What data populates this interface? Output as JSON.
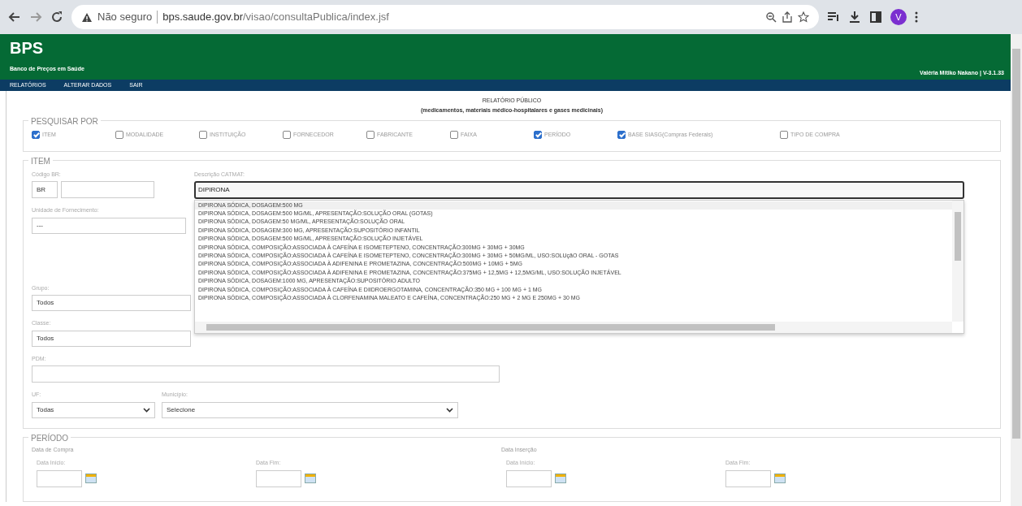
{
  "browser": {
    "security": "Não seguro",
    "url_host": "bps.saude.gov.br",
    "url_path": "/visao/consultaPublica/index.jsf",
    "profile": "V"
  },
  "header": {
    "title": "BPS",
    "subtitle": "Banco de Preços em Saúde",
    "user": "Valéria Mitiko Nakano | V-3.1.33"
  },
  "menu": [
    "RELATÓRIOS",
    "ALTERAR DADOS",
    "SAIR"
  ],
  "report": {
    "title": "RELATÓRIO PÚBLICO",
    "subtitle": "(medicamentos, materiais médico-hospitalares e gases medicinais)"
  },
  "search_by": {
    "legend": "PESQUISAR POR",
    "options": [
      {
        "label": "ITEM",
        "checked": true
      },
      {
        "label": "MODALIDADE",
        "checked": false
      },
      {
        "label": "INSTITUIÇÃO",
        "checked": false
      },
      {
        "label": "FORNECEDOR",
        "checked": false
      },
      {
        "label": "FABRICANTE",
        "checked": false
      },
      {
        "label": "FAIXA",
        "checked": false
      },
      {
        "label": "PERÍODO",
        "checked": true
      },
      {
        "label": "BASE SIASG(Compras Federais)",
        "checked": true
      },
      {
        "label": "TIPO DE COMPRA",
        "checked": false
      }
    ]
  },
  "item": {
    "legend": "ITEM",
    "codigo_label": "Código BR:",
    "codigo_prefix": "BR",
    "catmat_label": "Descrição CATMAT:",
    "catmat_value": "DIPIRONA",
    "suggestions": [
      {
        "text": "DIPIRONA SÓDICA, DOSAGEM:500 MG",
        "selected": true
      },
      {
        "text": "DIPIRONA SÓDICA, DOSAGEM:500 MG/ML, APRESENTAÇÃO:SOLUÇÃO ORAL (GOTAS)",
        "selected": false
      },
      {
        "text": "DIPIRONA SÓDICA, DOSAGEM:50 MG/ML, APRESENTAÇÃO:SOLUÇÃO ORAL",
        "selected": false
      },
      {
        "text": "DIPIRONA SÓDICA, DOSAGEM:300 MG, APRESENTAÇÃO:SUPOSITÓRIO INFANTIL",
        "selected": false
      },
      {
        "text": "DIPIRONA SÓDICA, DOSAGEM:500 MG/ML, APRESENTAÇÃO:SOLUÇÃO INJETÁVEL",
        "selected": false
      },
      {
        "text": "DIPIRONA SÓDICA, COMPOSIÇÃO:ASSOCIADA À CAFEÍNA E ISOMETEPTENO, CONCENTRAÇÃO:300MG + 30MG + 30MG",
        "selected": false
      },
      {
        "text": "DIPIRONA SÓDICA, COMPOSIÇÃO:ASSOCIADA À CAFEÍNA E ISOMETEPTENO, CONCENTRAÇÃO:300MG + 30MG + 50MG/ML, USO:SOLUçãO ORAL - GOTAS",
        "selected": false
      },
      {
        "text": "DIPIRONA SÓDICA, COMPOSIÇÃO:ASSOCIADA À ADIFENINA E PROMETAZINA, CONCENTRAÇÃO:500MG + 10MG + 5MG",
        "selected": false
      },
      {
        "text": "DIPIRONA SÓDICA, COMPOSIÇÃO:ASSOCIADA À ADIFENINA E PROMETAZINA, CONCENTRAÇÃO:375MG + 12,5MG + 12,5MG/ML, USO:SOLUÇÃO INJETÁVEL",
        "selected": false
      },
      {
        "text": "DIPIRONA SÓDICA, DOSAGEM:1000 MG, APRESENTAÇÃO:SUPOSITÓRIO ADULTO",
        "selected": false
      },
      {
        "text": "DIPIRONA SÓDICA, COMPOSIÇÃO:ASSOCIADA À CAFEÍNA E DIIDROERGOTAMINA, CONCENTRAÇÃO:350 MG + 100 MG + 1 MG",
        "selected": false
      },
      {
        "text": "DIPIRONA SÓDICA, COMPOSIÇÃO:ASSOCIADA À CLORFENAMINA MALEATO E CAFEÍNA, CONCENTRAÇÃO:250 MG + 2 MG E 250MG + 30 MG",
        "selected": false
      }
    ],
    "unidade_label": "Unidade de Fornecimento:",
    "unidade_value": "---",
    "grupo_label": "Grupo:",
    "grupo_value": "Todos",
    "classe_label": "Classe:",
    "classe_value": "Todos",
    "pdm_label": "PDM:",
    "uf_label": "UF:",
    "uf_value": "Todas",
    "municipio_label": "Município:",
    "municipio_value": "Selecione"
  },
  "periodo": {
    "legend": "PERÍODO",
    "groups": [
      {
        "label": "Data de Compra",
        "start_label": "Data Início:",
        "end_label": "Data Fim:"
      },
      {
        "label": "Data Inserção",
        "start_label": "Data Início:",
        "end_label": "Data Fim:"
      }
    ]
  }
}
